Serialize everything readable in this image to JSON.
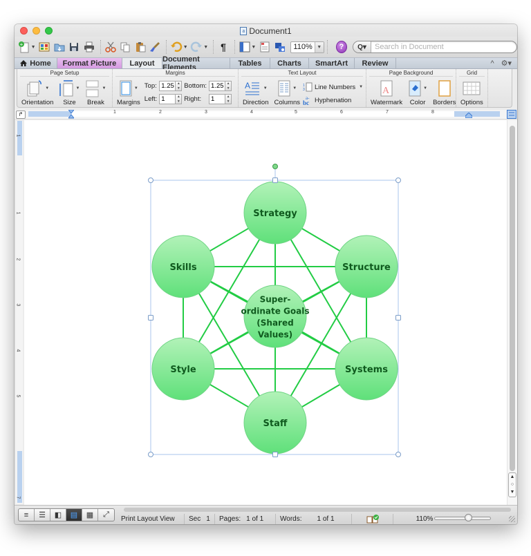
{
  "window": {
    "title": "Document1"
  },
  "toolbar": {
    "zoom_value": "110%",
    "help_label": "?",
    "search_scope": "Q▾",
    "search_placeholder": "Search in Document"
  },
  "tabs": [
    {
      "label": "Home",
      "icon": "home-icon"
    },
    {
      "label": "Format Picture"
    },
    {
      "label": "Layout",
      "active": true
    },
    {
      "label": "Document Elements"
    },
    {
      "label": "Tables"
    },
    {
      "label": "Charts"
    },
    {
      "label": "SmartArt"
    },
    {
      "label": "Review"
    }
  ],
  "tab_right": {
    "collapse": "^",
    "settings": "⚙▾"
  },
  "ribbon": {
    "page_setup": {
      "title": "Page Setup",
      "orientation": "Orientation",
      "size": "Size",
      "break": "Break"
    },
    "margins": {
      "title": "Margins",
      "button": "Margins",
      "top_label": "Top:",
      "top_value": "1.25",
      "bottom_label": "Bottom:",
      "bottom_value": "1.25",
      "left_label": "Left:",
      "left_value": "1",
      "right_label": "Right:",
      "right_value": "1"
    },
    "text_layout": {
      "title": "Text Layout",
      "direction": "Direction",
      "columns": "Columns",
      "line_numbers": "Line Numbers",
      "hyphenation": "Hyphenation"
    },
    "page_background": {
      "title": "Page Background",
      "watermark": "Watermark",
      "color": "Color",
      "borders": "Borders"
    },
    "grid": {
      "title": "Grid",
      "options": "Options"
    }
  },
  "ruler": {
    "h_numbers": [
      "1",
      "2",
      "3",
      "4",
      "5",
      "6",
      "7",
      "8"
    ],
    "v_numbers": [
      "1",
      "1",
      "2",
      "3",
      "4",
      "5",
      "7"
    ]
  },
  "diagram": {
    "nodes": [
      {
        "id": "strategy",
        "lines": [
          "Strategy"
        ]
      },
      {
        "id": "skills",
        "lines": [
          "Skills"
        ]
      },
      {
        "id": "structure",
        "lines": [
          "Structure"
        ]
      },
      {
        "id": "shared",
        "lines": [
          "Super-",
          "ordinate Goals",
          "(Shared",
          "Values)"
        ]
      },
      {
        "id": "style",
        "lines": [
          "Style"
        ]
      },
      {
        "id": "systems",
        "lines": [
          "Systems"
        ]
      },
      {
        "id": "staff",
        "lines": [
          "Staff"
        ]
      }
    ],
    "edges": [
      [
        "strategy",
        "skills"
      ],
      [
        "strategy",
        "structure"
      ],
      [
        "strategy",
        "shared"
      ],
      [
        "strategy",
        "style"
      ],
      [
        "strategy",
        "systems"
      ],
      [
        "strategy",
        "staff"
      ],
      [
        "skills",
        "structure"
      ],
      [
        "skills",
        "shared"
      ],
      [
        "skills",
        "style"
      ],
      [
        "skills",
        "systems"
      ],
      [
        "skills",
        "staff"
      ],
      [
        "structure",
        "shared"
      ],
      [
        "structure",
        "style"
      ],
      [
        "structure",
        "systems"
      ],
      [
        "structure",
        "staff"
      ],
      [
        "shared",
        "style"
      ],
      [
        "shared",
        "systems"
      ],
      [
        "shared",
        "staff"
      ],
      [
        "style",
        "systems"
      ],
      [
        "style",
        "staff"
      ],
      [
        "systems",
        "staff"
      ]
    ],
    "colors": {
      "circle_top": "#b2f2b8",
      "circle_bottom": "#5fe07a",
      "circle_stroke": "#6ed483",
      "edge": "#22cc44",
      "text": "#0f5a1e",
      "selection": "#a8c4ec"
    }
  },
  "statusbar": {
    "view_name": "Print Layout View",
    "sec_label": "Sec",
    "sec_value": "1",
    "pages_label": "Pages:",
    "pages_value": "1 of 1",
    "words_label": "Words:",
    "words_value": "1 of 1",
    "zoom_value": "110%",
    "zoom_slider_fraction": 0.6,
    "views": [
      "Draft",
      "Outline",
      "Publishing Layout",
      "Print Layout",
      "Notebook Layout",
      "Full Screen"
    ]
  }
}
